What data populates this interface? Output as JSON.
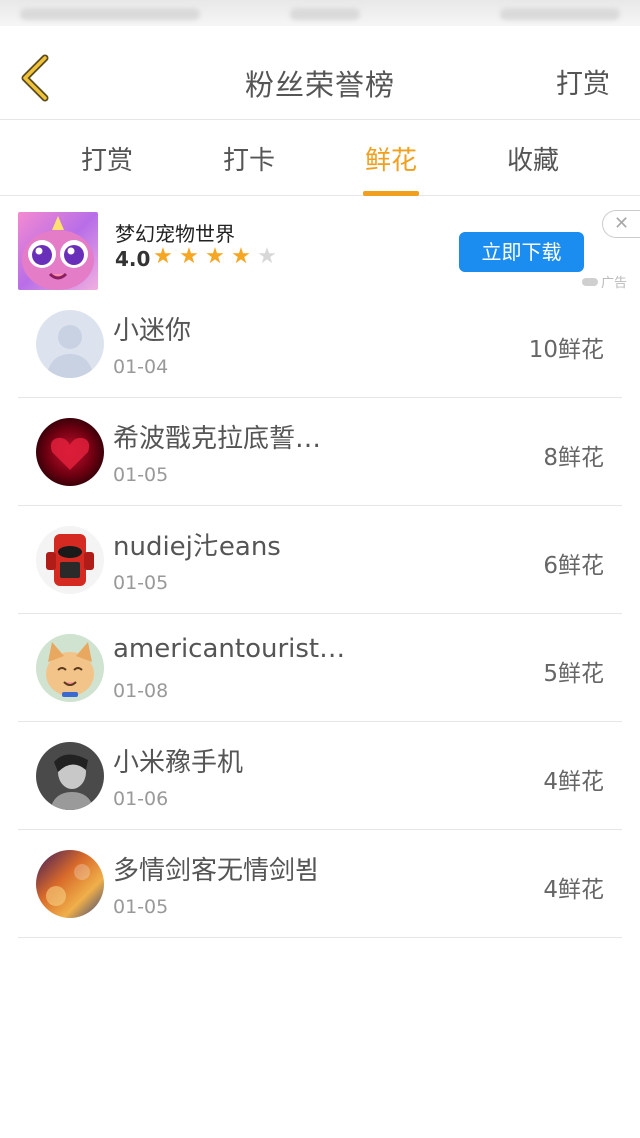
{
  "header": {
    "title": "粉丝荣誉榜",
    "action_label": "打赏",
    "back_icon": "chevron-left-icon",
    "accent_color": "#f0a01e"
  },
  "tabs": [
    {
      "label": "打赏",
      "active": false
    },
    {
      "label": "打卡",
      "active": false
    },
    {
      "label": "鲜花",
      "active": true
    },
    {
      "label": "收藏",
      "active": false
    }
  ],
  "ad": {
    "title": "梦幻宠物世界",
    "rating": "4.0",
    "stars": 4,
    "max_stars": 5,
    "button_label": "立即下载",
    "close_glyph": "✕",
    "ad_label": "广告",
    "button_color": "#1b8cf0"
  },
  "fans": [
    {
      "name": "小迷你",
      "date": "01-04",
      "value": "10鲜花"
    },
    {
      "name": "希波戬克拉底誓…",
      "date": "01-05",
      "value": "8鲜花"
    },
    {
      "name": "nudiej㲺eans",
      "date": "01-05",
      "value": "6鲜花"
    },
    {
      "name": "americantourist…",
      "date": "01-08",
      "value": "5鲜花"
    },
    {
      "name": "小米䂊手机",
      "date": "01-06",
      "value": "4鲜花"
    },
    {
      "name": "多情剑客无情剑뵘",
      "date": "01-05",
      "value": "4鲜花"
    }
  ]
}
